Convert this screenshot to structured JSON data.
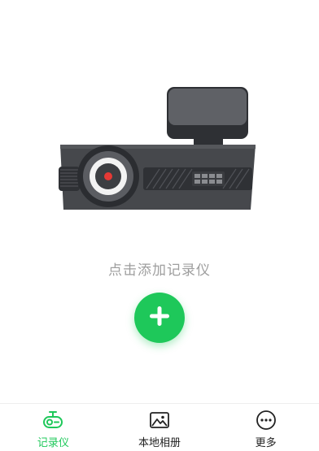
{
  "colors": {
    "accent": "#1ec85a",
    "text_muted": "#9e9e9e",
    "text_default": "#222222",
    "device_body": "#45474b",
    "lens_red": "#e53935"
  },
  "main": {
    "empty_text": "点击添加记录仪",
    "add_button_icon": "plus-icon"
  },
  "tabbar": {
    "tabs": [
      {
        "label": "记录仪",
        "icon": "dashcam-icon",
        "active": true
      },
      {
        "label": "本地相册",
        "icon": "photo-album-icon",
        "active": false
      },
      {
        "label": "更多",
        "icon": "more-dots-icon",
        "active": false
      }
    ]
  }
}
